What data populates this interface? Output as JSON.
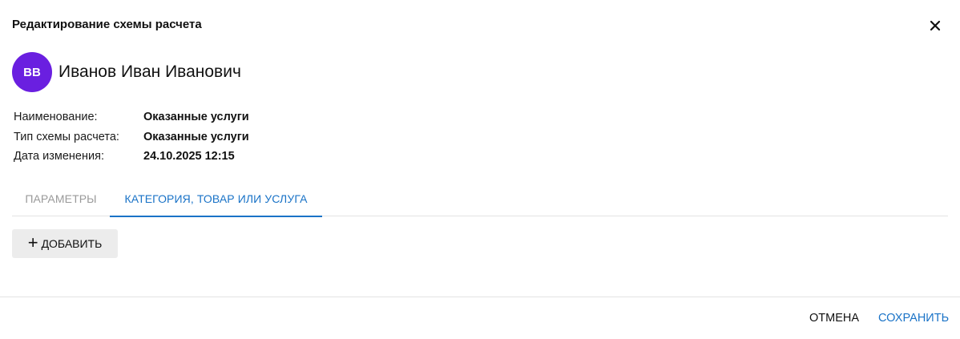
{
  "dialog": {
    "title": "Редактирование схемы расчета",
    "close_icon": "close-icon"
  },
  "user": {
    "initials": "ВВ",
    "name": "Иванов Иван Иванович",
    "avatar_color": "#6a1fe0"
  },
  "info": {
    "rows": [
      {
        "label": "Наименование:",
        "value": "Оказанные услуги"
      },
      {
        "label": "Тип схемы расчета:",
        "value": "Оказанные услуги"
      },
      {
        "label": "Дата изменения:",
        "value": "24.10.2025 12:15"
      }
    ]
  },
  "tabs": [
    {
      "label": "ПАРАМЕТРЫ",
      "active": false
    },
    {
      "label": "КАТЕГОРИЯ, ТОВАР ИЛИ УСЛУГА",
      "active": true
    }
  ],
  "add_button": {
    "label": "ДОБАВИТЬ",
    "icon": "plus-icon"
  },
  "footer": {
    "cancel_label": "ОТМЕНА",
    "save_label": "СОХРАНИТЬ"
  },
  "colors": {
    "accent": "#1a73c7",
    "inactive_tab": "#9a9a9a"
  }
}
